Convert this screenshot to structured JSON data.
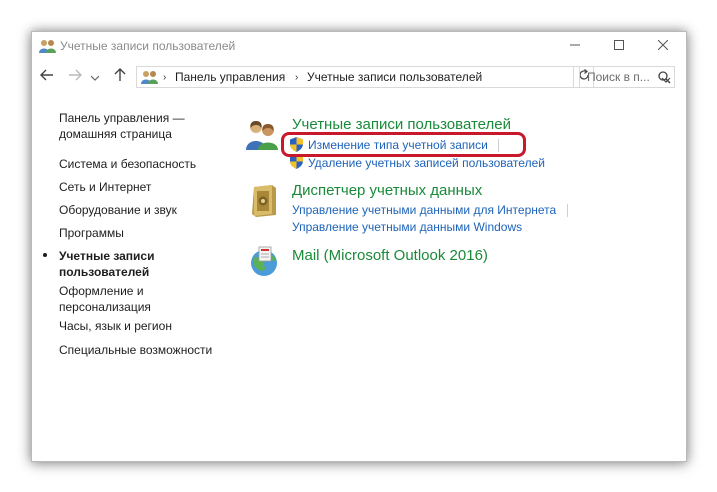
{
  "window": {
    "title": "Учетные записи пользователей",
    "minimize_icon": "minimize-icon",
    "maximize_icon": "maximize-icon",
    "close_icon": "close-icon"
  },
  "nav": {
    "back_icon": "back-arrow-icon",
    "forward_icon": "forward-arrow-icon",
    "dropdown_icon": "chevron-down-icon",
    "up_icon": "up-arrow-icon",
    "breadcrumbs": [
      "Панель управления",
      "Учетные записи пользователей"
    ],
    "refresh_icon": "refresh-icon",
    "search_placeholder": "Поиск в п..."
  },
  "sidebar": {
    "home_line1": "Панель управления —",
    "home_line2": "домашняя страница",
    "items": [
      "Система и безопасность",
      "Сеть и Интернет",
      "Оборудование и звук",
      "Программы"
    ],
    "active_line1": "Учетные записи",
    "active_line2": "пользователей",
    "appearance_line1": "Оформление и",
    "appearance_line2": "персонализация",
    "items_after": [
      "Часы, язык и регион",
      "Специальные возможности"
    ]
  },
  "main": {
    "categories": [
      {
        "title": "Учетные записи пользователей",
        "icon": "users-icon",
        "links": [
          "Изменение типа учетной записи",
          "Удаление учетных записей пользователей"
        ]
      },
      {
        "title": "Диспетчер учетных данных",
        "icon": "credential-vault-icon",
        "links": [
          "Управление учетными данными для Интернета",
          "Управление учетными данными Windows"
        ]
      },
      {
        "title": "Mail (Microsoft Outlook 2016)",
        "icon": "mail-globe-icon",
        "links": []
      }
    ]
  },
  "colors": {
    "category_title": "#1a8a3a",
    "link": "#1e63b9",
    "highlight": "#c8182b"
  }
}
